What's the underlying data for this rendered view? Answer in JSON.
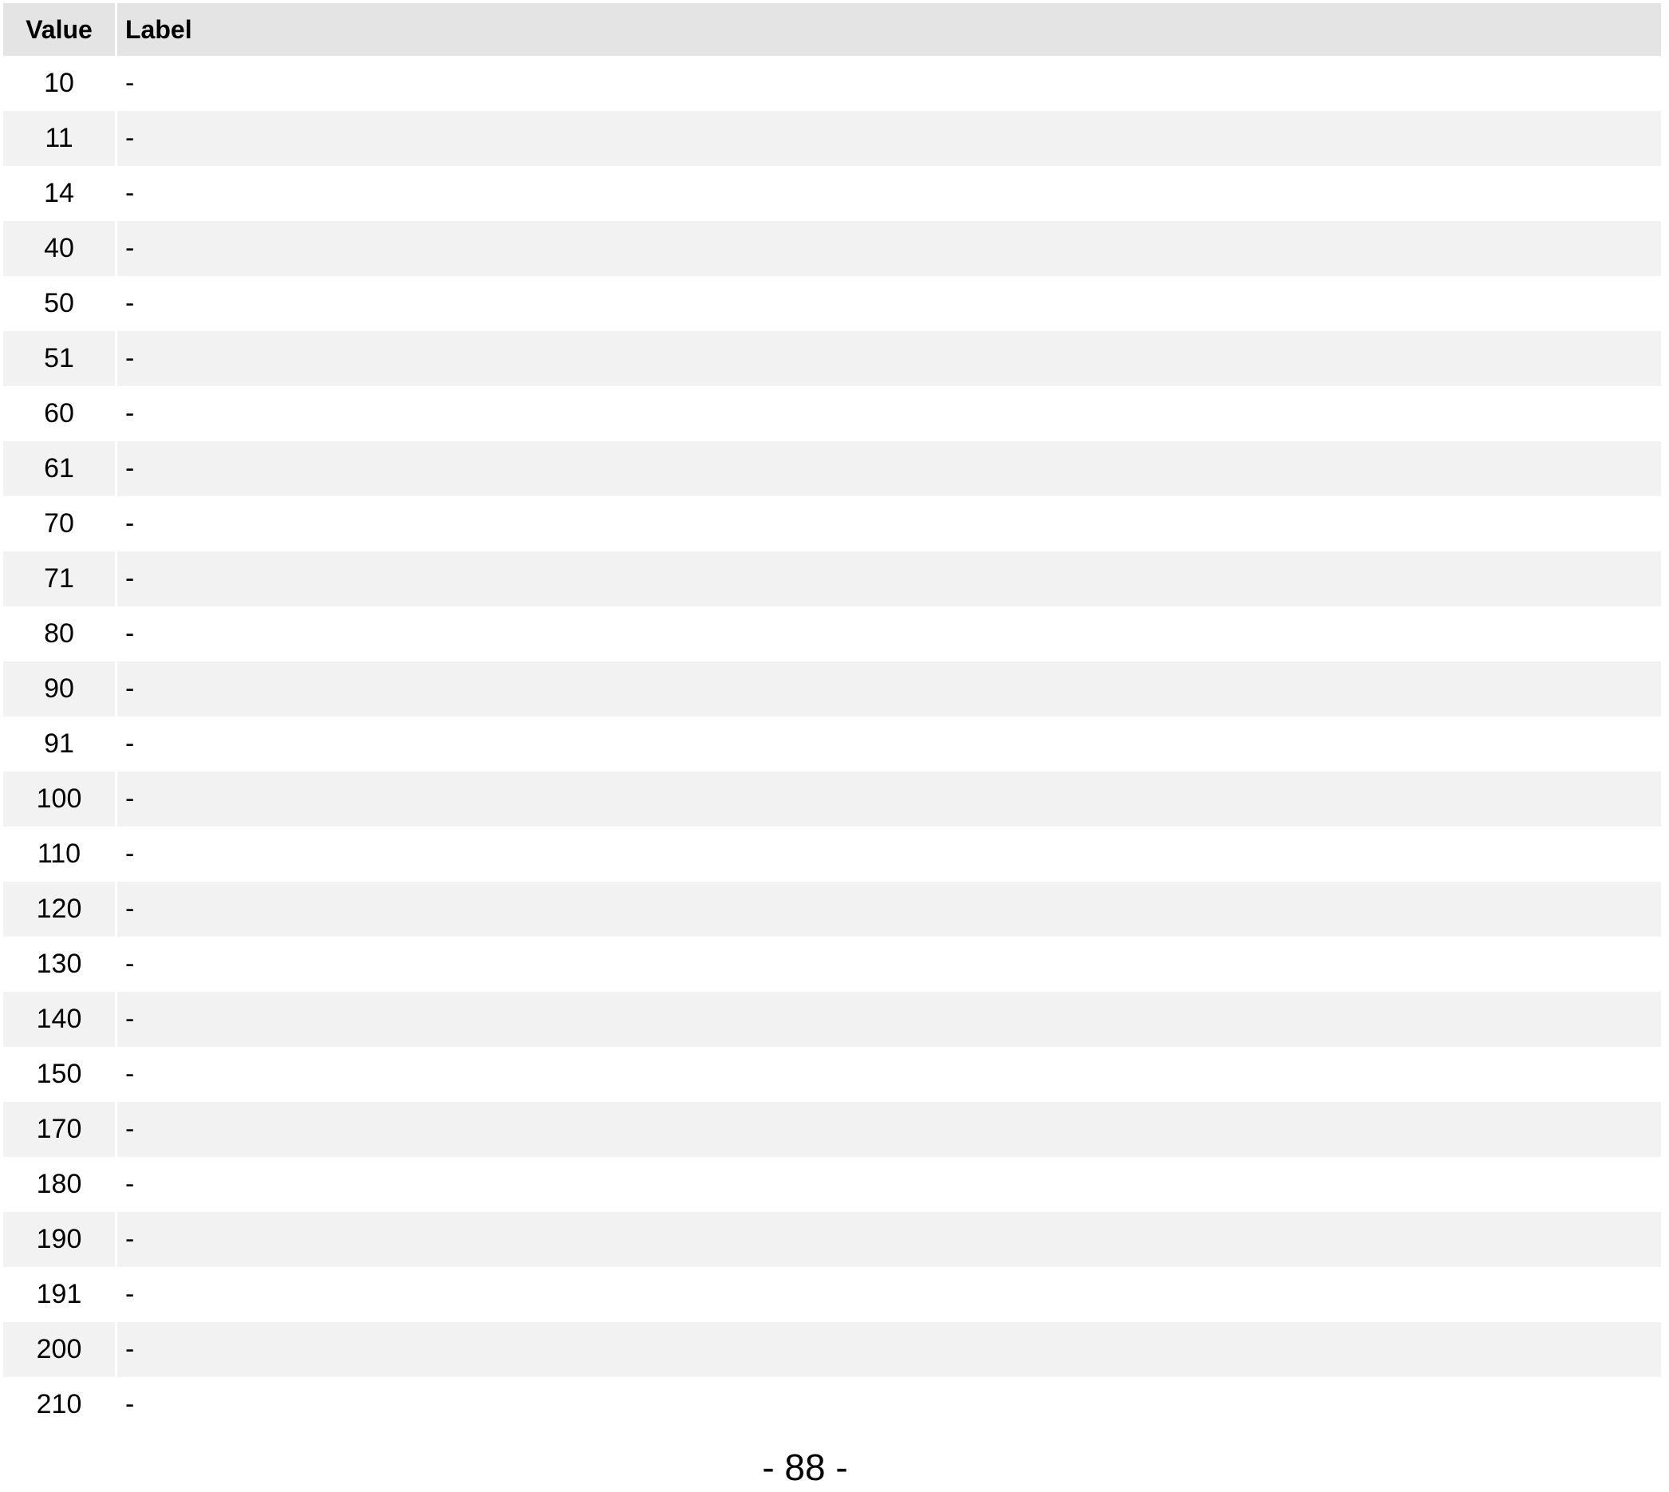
{
  "table": {
    "headers": {
      "value": "Value",
      "label": "Label"
    },
    "rows": [
      {
        "value": "10",
        "label": "-"
      },
      {
        "value": "11",
        "label": "-"
      },
      {
        "value": "14",
        "label": "-"
      },
      {
        "value": "40",
        "label": "-"
      },
      {
        "value": "50",
        "label": "-"
      },
      {
        "value": "51",
        "label": "-"
      },
      {
        "value": "60",
        "label": "-"
      },
      {
        "value": "61",
        "label": "-"
      },
      {
        "value": "70",
        "label": "-"
      },
      {
        "value": "71",
        "label": "-"
      },
      {
        "value": "80",
        "label": "-"
      },
      {
        "value": "90",
        "label": "-"
      },
      {
        "value": "91",
        "label": "-"
      },
      {
        "value": "100",
        "label": "-"
      },
      {
        "value": "110",
        "label": "-"
      },
      {
        "value": "120",
        "label": "-"
      },
      {
        "value": "130",
        "label": "-"
      },
      {
        "value": "140",
        "label": "-"
      },
      {
        "value": "150",
        "label": "-"
      },
      {
        "value": "170",
        "label": "-"
      },
      {
        "value": "180",
        "label": "-"
      },
      {
        "value": "190",
        "label": "-"
      },
      {
        "value": "191",
        "label": "-"
      },
      {
        "value": "200",
        "label": "-"
      },
      {
        "value": "210",
        "label": "-"
      }
    ]
  },
  "footer": {
    "page_number": "- 88 -"
  },
  "colors": {
    "header_background": "#e4e4e4",
    "alternate_row_background": "#f2f2f2",
    "row_background": "#ffffff"
  }
}
